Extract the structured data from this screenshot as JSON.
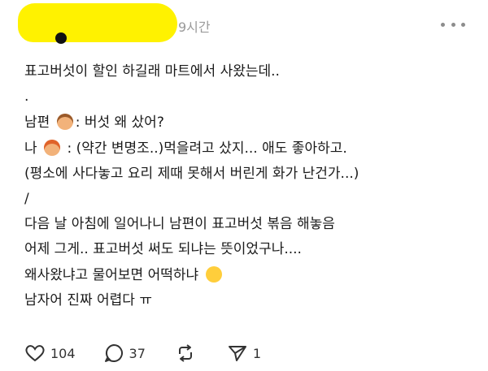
{
  "header": {
    "time": "9시간"
  },
  "post": {
    "lines": [
      "표고버섯이 할인 하길래 마트에서 사왔는데..",
      ".",
      "남편 ",
      ": 버섯 왜 샀어?",
      "나 ",
      " : (약간 변명조..)먹을려고 샀지... 애도 좋아하고.",
      "(평소에 사다놓고 요리 제때 못해서 버린게 화가 난건가...)",
      "/",
      "다음 날 아침에 일어나니 남편이 표고버섯 볶음 해놓음",
      "어제 그게.. 표고버섯 써도 되냐는 뜻이었구나....",
      "왜사왔냐고 물어보면 어떡하냐 ",
      "남자어 진짜 어렵다 ㅠ"
    ]
  },
  "actions": {
    "likes": "104",
    "comments": "37",
    "shares": "1"
  },
  "icons": {
    "like": "heart-icon",
    "comment": "comment-icon",
    "repost": "repost-icon",
    "share": "send-icon",
    "more": "more-icon"
  }
}
